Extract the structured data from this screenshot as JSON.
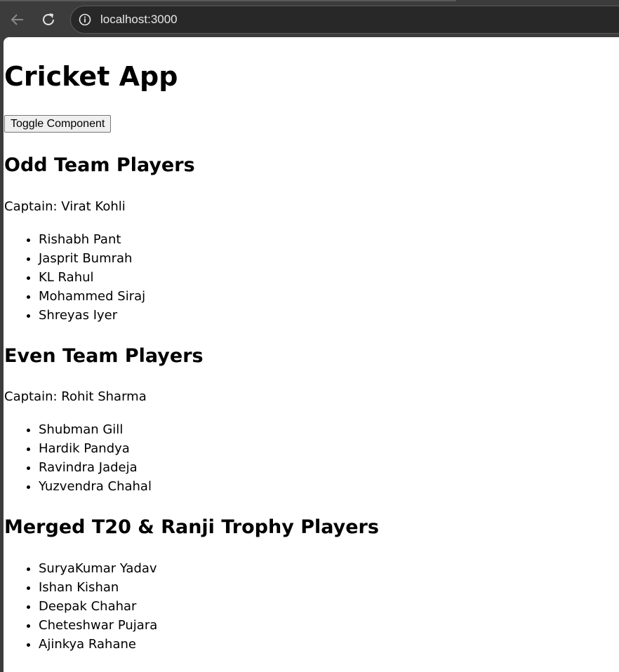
{
  "browser": {
    "url": "localhost:3000"
  },
  "app": {
    "title": "Cricket App",
    "toggle_label": "Toggle Component"
  },
  "odd_team": {
    "heading": "Odd Team Players",
    "captain": "Captain: Virat Kohli",
    "players": [
      "Rishabh Pant",
      "Jasprit Bumrah",
      "KL Rahul",
      "Mohammed Siraj",
      "Shreyas Iyer"
    ]
  },
  "even_team": {
    "heading": "Even Team Players",
    "captain": "Captain: Rohit Sharma",
    "players": [
      "Shubman Gill",
      "Hardik Pandya",
      "Ravindra Jadeja",
      "Yuzvendra Chahal"
    ]
  },
  "merged": {
    "heading": "Merged T20 & Ranji Trophy Players",
    "players": [
      "SuryaKumar Yadav",
      "Ishan Kishan",
      "Deepak Chahar",
      "Cheteshwar Pujara",
      "Ajinkya Rahane"
    ]
  }
}
